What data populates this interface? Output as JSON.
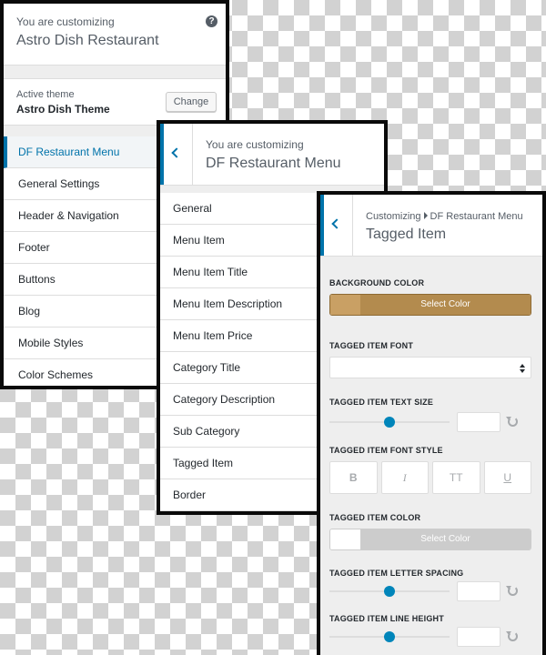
{
  "panel1": {
    "customizing_label": "You are customizing",
    "site_title": "Astro Dish Restaurant",
    "help_symbol": "?",
    "active_theme_label": "Active theme",
    "theme_name": "Astro Dish Theme",
    "change_label": "Change",
    "menu": [
      "DF Restaurant Menu",
      "General Settings",
      "Header & Navigation",
      "Footer",
      "Buttons",
      "Blog",
      "Mobile Styles",
      "Color Schemes"
    ],
    "active_index": 0
  },
  "panel2": {
    "customizing_label": "You are customizing",
    "title": "DF Restaurant Menu",
    "menu": [
      "General",
      "Menu Item",
      "Menu Item Title",
      "Menu Item Description",
      "Menu Item Price",
      "Category Title",
      "Category Description",
      "Sub Category",
      "Tagged Item",
      "Border"
    ]
  },
  "panel3": {
    "breadcrumb_root": "Customizing",
    "breadcrumb_parent": "DF Restaurant Menu",
    "title": "Tagged Item",
    "background_color": {
      "label": "BACKGROUND COLOR",
      "button_label": "Select Color",
      "value": "#b38b4e"
    },
    "font": {
      "label": "TAGGED ITEM FONT",
      "value": ""
    },
    "text_size": {
      "label": "TAGGED ITEM TEXT SIZE",
      "level": 0.5
    },
    "font_style": {
      "label": "TAGGED ITEM FONT STYLE",
      "buttons": [
        "B",
        "I",
        "TT",
        "U"
      ]
    },
    "item_color": {
      "label": "TAGGED ITEM COLOR",
      "button_label": "Select Color",
      "value": "#ffffff"
    },
    "letter_spacing": {
      "label": "TAGGED ITEM LETTER SPACING",
      "level": 0.5
    },
    "line_height": {
      "label": "TAGGED ITEM LINE HEIGHT",
      "level": 0.5
    }
  },
  "colors": {
    "accent": "#0073aa",
    "slider_knob": "#0085ba",
    "bg_swatch": "#c9a064",
    "bg_face": "#b38b4e"
  }
}
